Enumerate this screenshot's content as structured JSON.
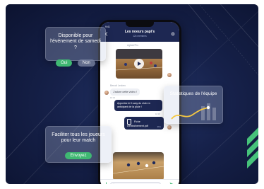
{
  "chat": {
    "status_time": "9:41",
    "title": "Les noeurs papi's",
    "subtitle": "124 membres",
    "video_author": "Agilab/Pro",
    "sender": "Benoit Leclerc",
    "incoming_message": "J'adore cette vidéo !",
    "incoming_time": "10:13",
    "outgoing_message": "Apportez le K-way du club en anticipant de la pluie !",
    "outgoing_time": "10:15",
    "file_name": "Fiche d'entraînement.pdf",
    "file_size": "2Ko",
    "input_placeholder": "Écrire un message..."
  },
  "availability_card": {
    "question": "Disponible pour l'événement de samedi ?",
    "yes_label": "Oui",
    "no_label": "Non"
  },
  "stats_card": {
    "title": "Statistiques de l'équipe"
  },
  "share_card": {
    "text": "Faciliter tous les joueurs pour leur match",
    "button_label": "Envoyez"
  },
  "colors": {
    "background": "#16214a",
    "header": "#1d2752",
    "accent_green": "#3fb872",
    "stat_line": "#f5c842"
  },
  "icons": [
    "back-icon",
    "settings-icon",
    "play-icon",
    "file-icon",
    "plus-icon",
    "send-icon"
  ]
}
